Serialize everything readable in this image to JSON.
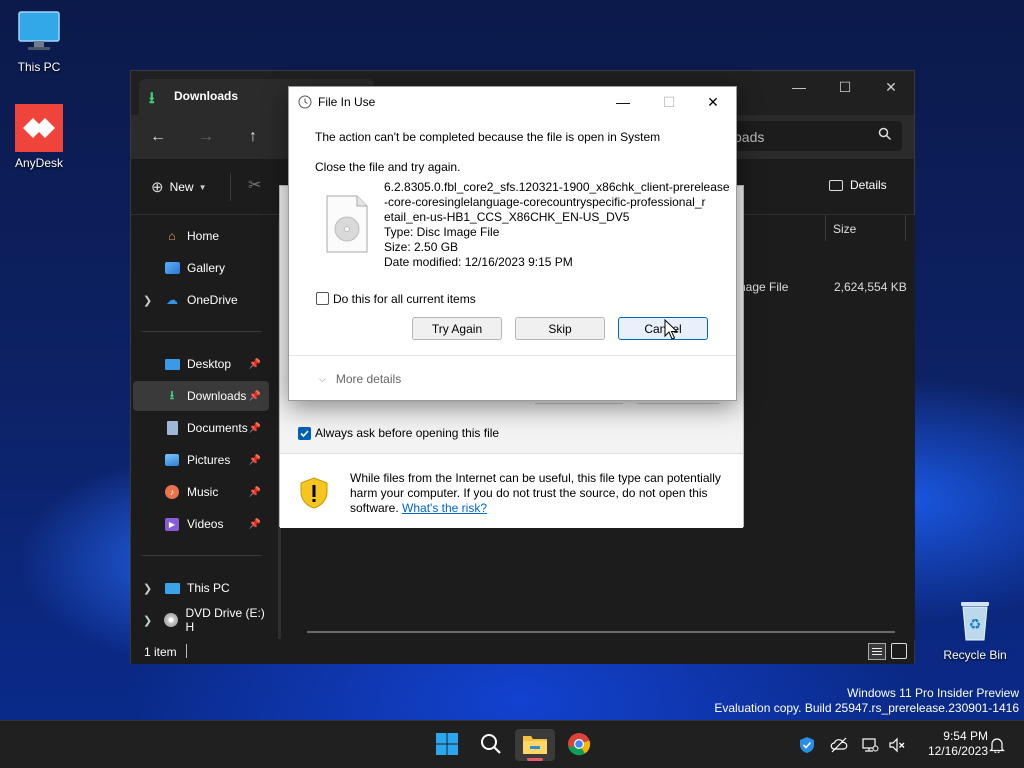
{
  "desktop": {
    "icons": [
      {
        "label": "This PC"
      },
      {
        "label": "AnyDesk"
      },
      {
        "label": "Recycle Bin"
      }
    ],
    "watermark": {
      "line1": "Windows 11 Pro Insider Preview",
      "line2": "Evaluation copy. Build 25947.rs_prerelease.230901-1416"
    }
  },
  "explorer": {
    "tab_title": "Downloads",
    "search_text": "oads",
    "toolbar": {
      "new_label": "New",
      "details_label": "Details"
    },
    "columns": {
      "size": "Size"
    },
    "file_row": {
      "type": "nage File",
      "size": "2,624,554 KB"
    },
    "sidebar": {
      "items": [
        {
          "label": "Home"
        },
        {
          "label": "Gallery"
        },
        {
          "label": "OneDrive"
        },
        {
          "label": "Desktop"
        },
        {
          "label": "Downloads"
        },
        {
          "label": "Documents"
        },
        {
          "label": "Pictures"
        },
        {
          "label": "Music"
        },
        {
          "label": "Videos"
        },
        {
          "label": "This PC"
        },
        {
          "label": "DVD Drive (E:) H"
        }
      ]
    },
    "status": {
      "item_count": "1 item"
    }
  },
  "security_warning": {
    "checkbox_label": "Always ask before opening this file",
    "message": "While files from the Internet can be useful, this file type can potentially harm your computer. If you do not trust the source, do not open this software.",
    "link_label": "What's the risk?"
  },
  "file_in_use": {
    "title": "File In Use",
    "message": "The action can't be completed because the file is open in System",
    "instruction": "Close the file and try again.",
    "file": {
      "name_line1": "6.2.8305.0.fbl_core2_sfs.120321-1900_x86chk_client-prerelease",
      "name_line2": "-core-coresinglelanguage-corecountryspecific-professional_r",
      "name_line3": "etail_en-us-HB1_CCS_X86CHK_EN-US_DV5",
      "type": "Type: Disc Image File",
      "size": "Size: 2.50 GB",
      "modified": "Date modified: 12/16/2023 9:15 PM"
    },
    "checkbox_label": "Do this for all current items",
    "buttons": {
      "try_again": "Try Again",
      "skip": "Skip",
      "cancel": "Cancel"
    },
    "more_details": "More details"
  },
  "taskbar": {
    "clock": {
      "time": "9:54 PM",
      "date": "12/16/2023"
    }
  }
}
